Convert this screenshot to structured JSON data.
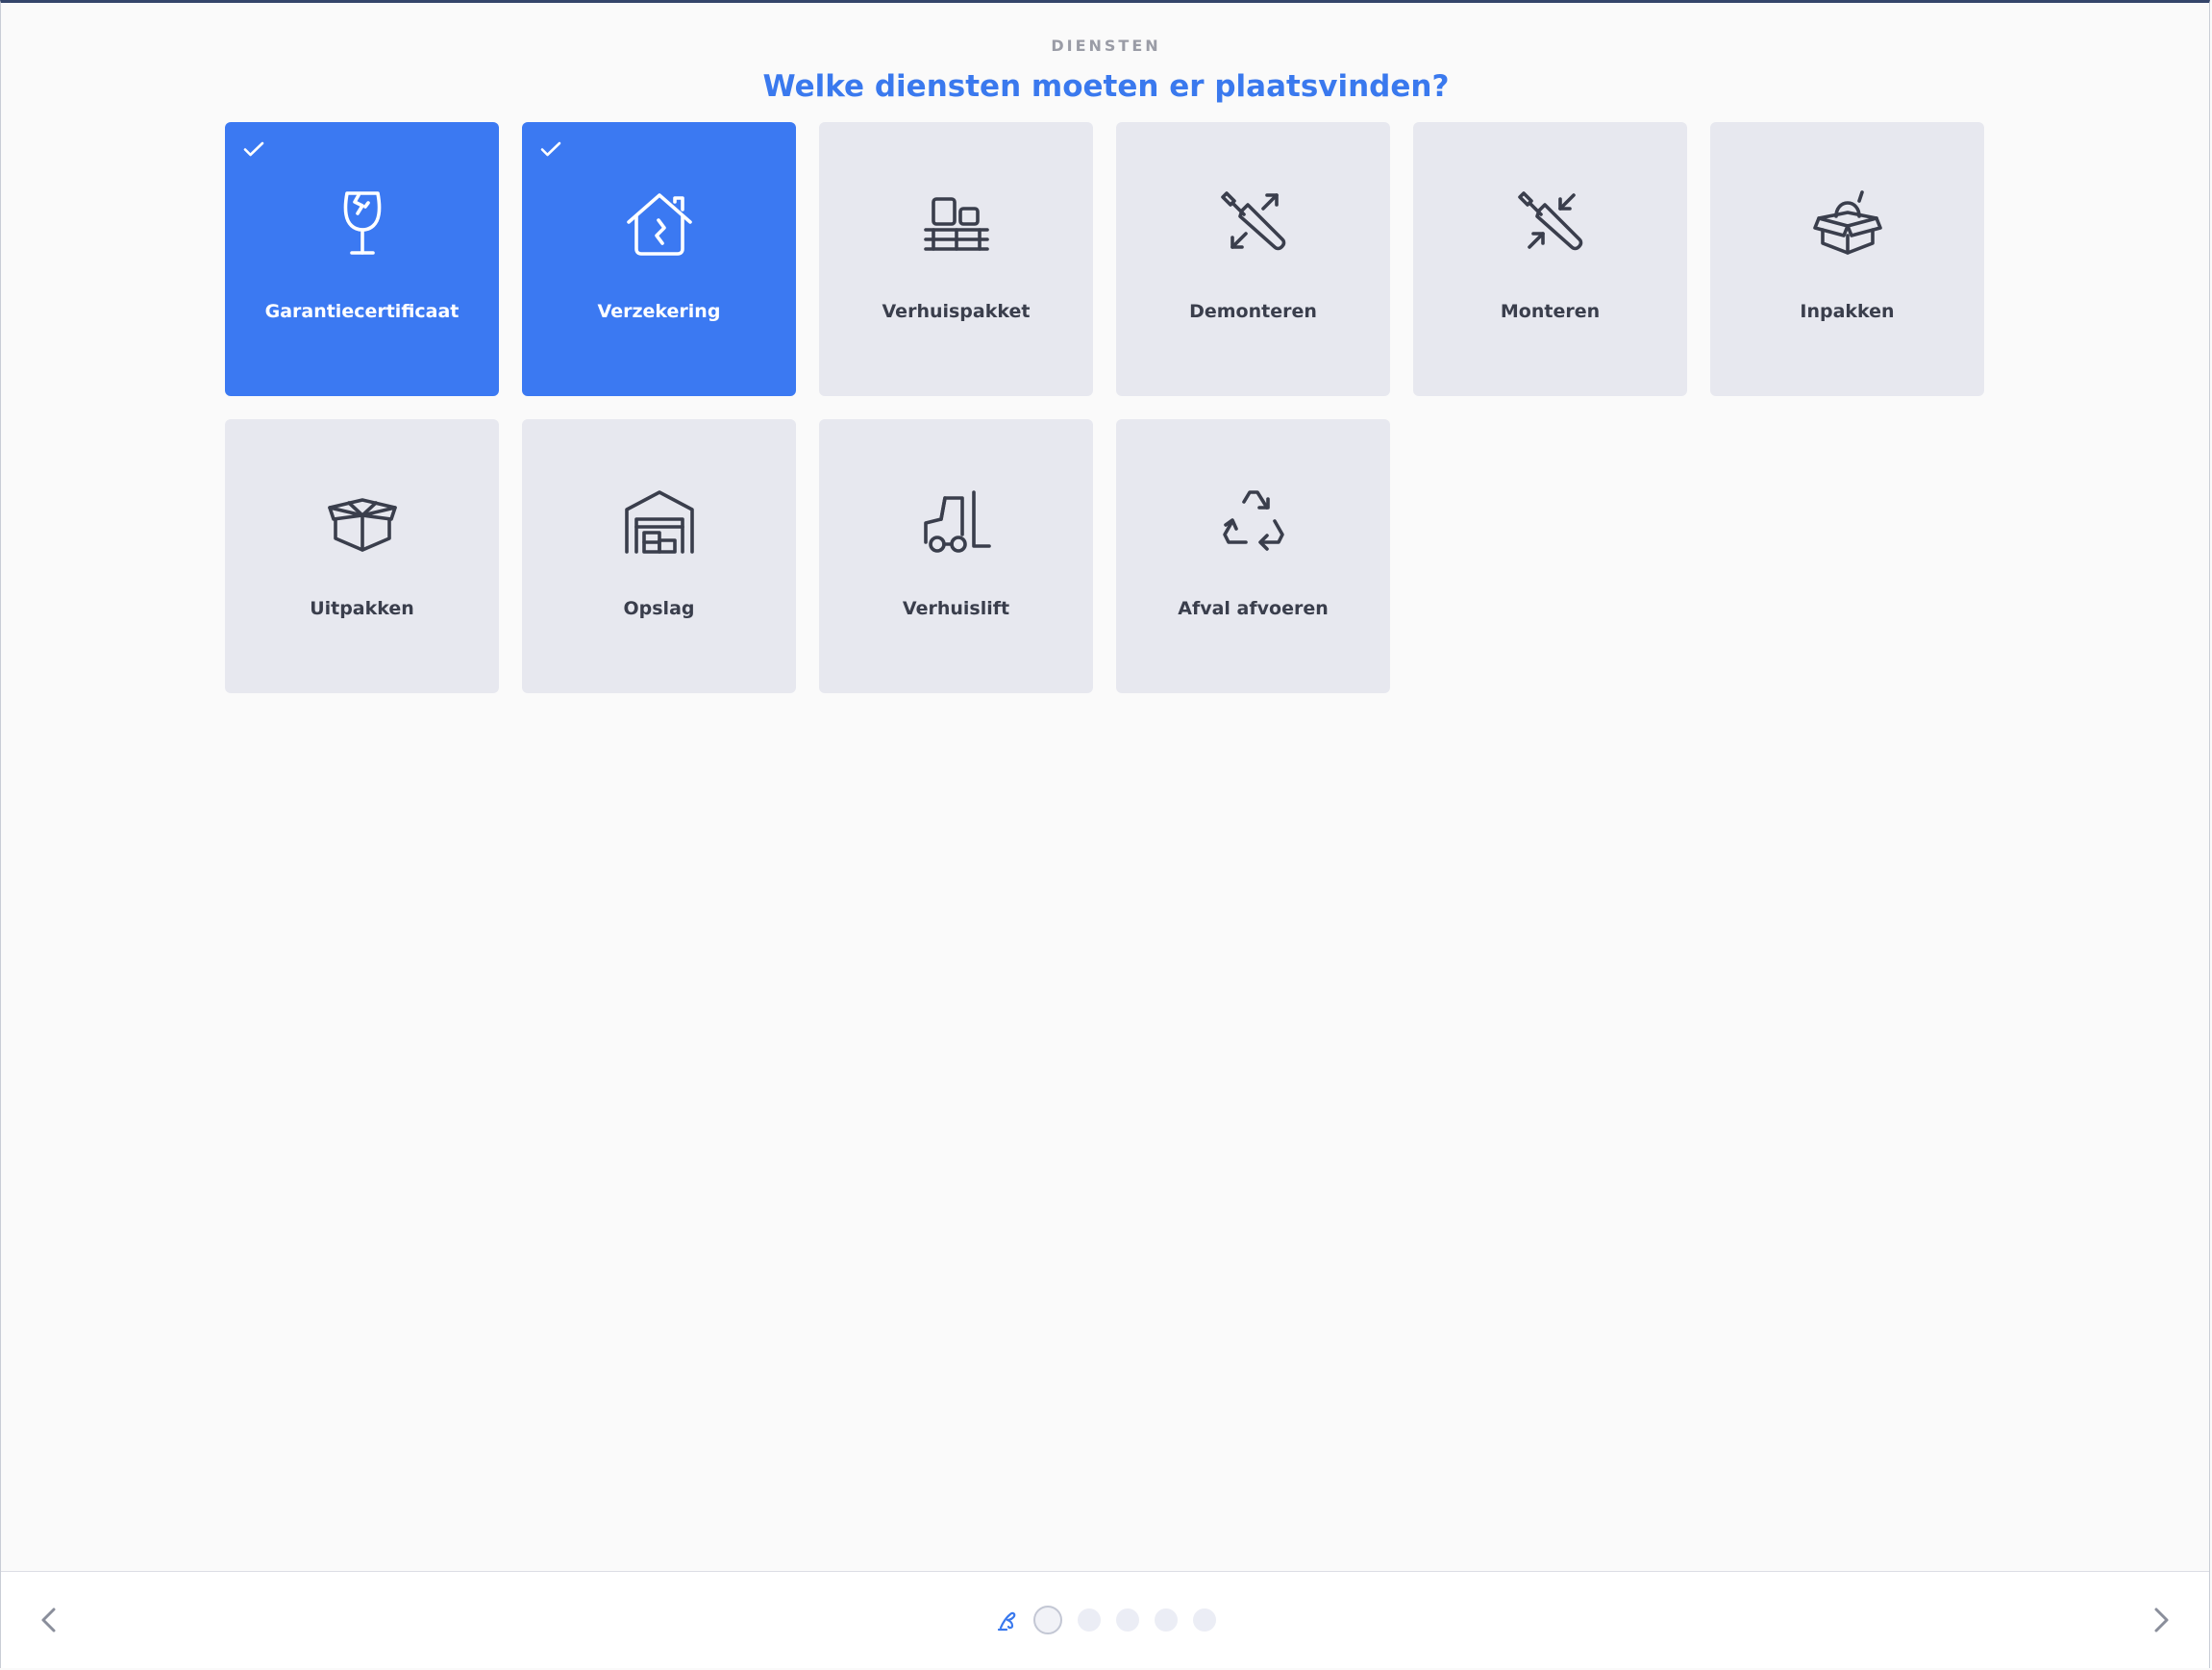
{
  "header": {
    "eyebrow": "DIENSTEN",
    "title": "Welke diensten moeten er plaatsvinden?"
  },
  "colors": {
    "accent": "#3b79f2",
    "card_bg": "#e7e8ef",
    "title": "#3a79ee"
  },
  "services": [
    {
      "label": "Garantiecertificaat",
      "icon": "fragile-glass-icon",
      "selected": true
    },
    {
      "label": "Verzekering",
      "icon": "house-insurance-icon",
      "selected": true
    },
    {
      "label": "Verhuispakket",
      "icon": "moving-boxes-icon",
      "selected": false
    },
    {
      "label": "Demonteren",
      "icon": "screwdriver-disassemble-icon",
      "selected": false
    },
    {
      "label": "Monteren",
      "icon": "screwdriver-assemble-icon",
      "selected": false
    },
    {
      "label": "Inpakken",
      "icon": "pack-box-icon",
      "selected": false
    },
    {
      "label": "Uitpakken",
      "icon": "open-box-icon",
      "selected": false
    },
    {
      "label": "Opslag",
      "icon": "storage-warehouse-icon",
      "selected": false
    },
    {
      "label": "Verhuislift",
      "icon": "forklift-icon",
      "selected": false
    },
    {
      "label": "Afval afvoeren",
      "icon": "recycle-icon",
      "selected": false
    }
  ],
  "footer": {
    "prev_icon": "chevron-left-icon",
    "next_icon": "chevron-right-icon",
    "step_count": 5,
    "active_step": 1
  }
}
